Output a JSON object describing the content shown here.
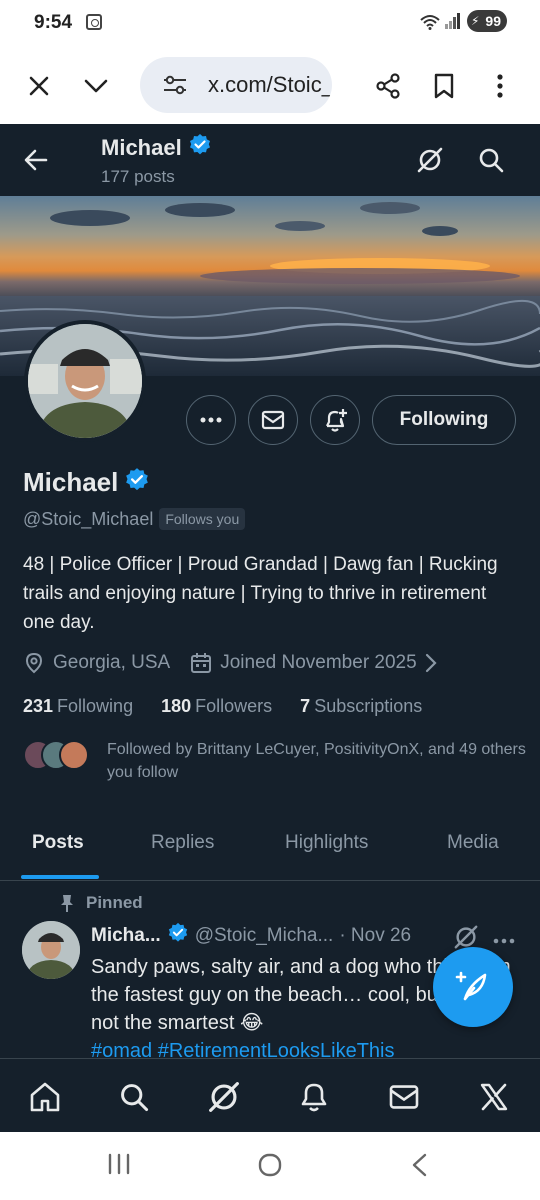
{
  "status_bar": {
    "time": "9:54",
    "battery": "99"
  },
  "browser": {
    "url": "x.com/Stoic_Michael",
    "icons": [
      "close-icon",
      "chevron-down-icon",
      "site-settings-icon",
      "share-icon",
      "bookmark-icon",
      "more-vert-icon"
    ]
  },
  "header": {
    "title": "Michael",
    "post_count": "177 posts"
  },
  "profile": {
    "name": "Michael",
    "handle": "@Stoic_Michael",
    "follows_you": "Follows you",
    "following_button": "Following",
    "bio": "48 | Police Officer | Proud Grandad | Dawg fan | Rucking trails and enjoying nature | Trying to thrive in retirement one day.",
    "location": "Georgia, USA",
    "joined": "Joined November 2025",
    "following_count": "231",
    "following_label": "Following",
    "followers_count": "180",
    "followers_label": "Followers",
    "subscriptions_count": "7",
    "subscriptions_label": "Subscriptions",
    "followed_by": "Followed by Brittany LeCuyer, PositivityOnX, and 49 others you follow"
  },
  "tabs": [
    {
      "label": "Posts",
      "active": true
    },
    {
      "label": "Replies",
      "active": false
    },
    {
      "label": "Highlights",
      "active": false
    },
    {
      "label": "Media",
      "active": false
    }
  ],
  "pinned_post": {
    "pinned_label": "Pinned",
    "author": "Micha...",
    "handle": "@Stoic_Micha...",
    "date": "· Nov 26",
    "text": "Sandy paws, salty air, and a dog who thinks I'm the fastest guy on the beach… cool, but maybe not the smartest 😂",
    "hashtags": "#omad #RetirementLooksLikeThis"
  },
  "bottom_nav": [
    "home-icon",
    "search-icon",
    "grok-icon",
    "notifications-icon",
    "messages-icon",
    "x-logo-icon"
  ],
  "colors": {
    "background": "#15202b",
    "accent": "#1d9bf0",
    "muted": "#8b98a5",
    "text": "#e7e9ea",
    "border": "#536471"
  }
}
